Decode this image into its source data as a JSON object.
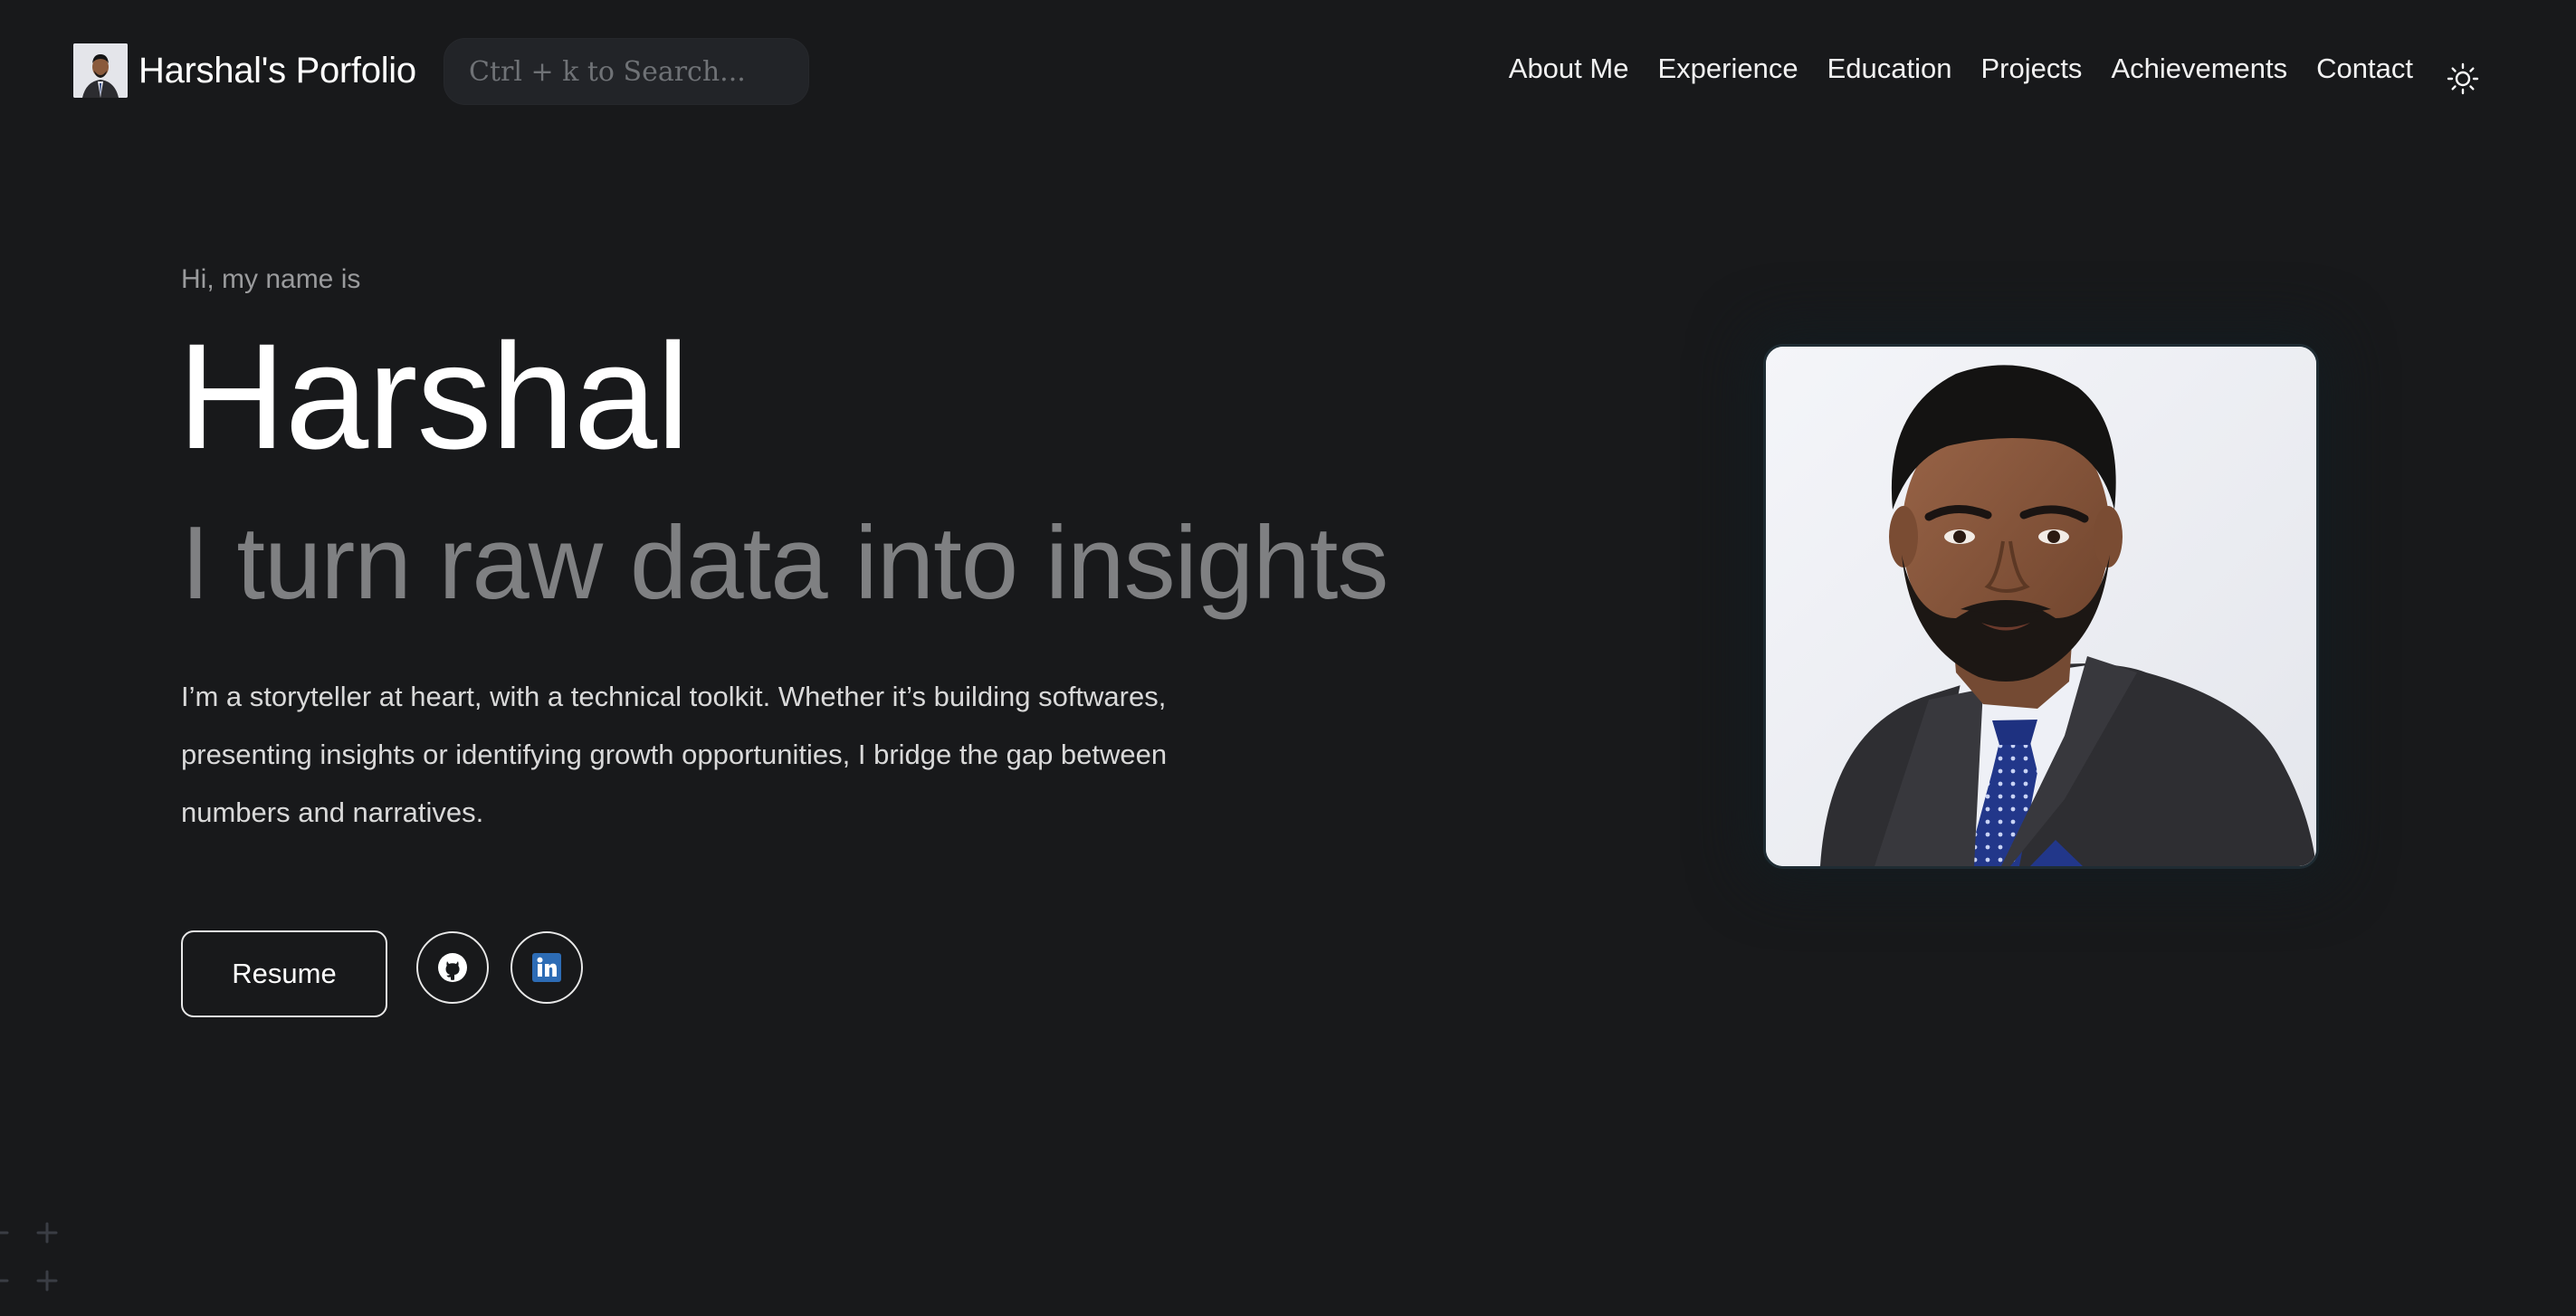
{
  "brand": {
    "title": "Harshal's Porfolio",
    "avatar_icon": "profile-avatar"
  },
  "search": {
    "placeholder": "Ctrl + k to Search..."
  },
  "nav": {
    "items": [
      {
        "label": "About Me"
      },
      {
        "label": "Experience"
      },
      {
        "label": "Education"
      },
      {
        "label": "Projects"
      },
      {
        "label": "Achievements"
      },
      {
        "label": "Contact"
      }
    ],
    "theme_icon": "sun-icon"
  },
  "hero": {
    "greeting": "Hi, my name is",
    "name": "Harshal",
    "tagline": "I turn raw data into insights",
    "description": "I’m a storyteller at heart, with a technical toolkit. Whether it’s building softwares, presenting insights or identifying growth opportunities, I bridge the gap between numbers and narratives.",
    "resume_label": "Resume",
    "social": [
      {
        "name": "github",
        "icon": "github-icon"
      },
      {
        "name": "linkedin",
        "icon": "linkedin-icon"
      }
    ]
  },
  "colors": {
    "background": "#18191b",
    "primary_text": "#ffffff",
    "muted_text": "#7f8082",
    "search_bg": "#222428",
    "linkedin_blue": "#2d6cb5"
  }
}
